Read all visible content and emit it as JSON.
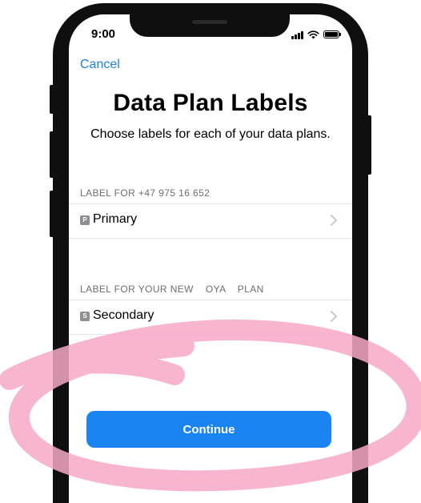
{
  "status_bar": {
    "time": "9:00",
    "icons": [
      "signal-icon",
      "wifi-icon",
      "battery-icon"
    ]
  },
  "nav": {
    "cancel_label": "Cancel"
  },
  "header": {
    "title": "Data Plan Labels",
    "subtitle": "Choose labels for each of your data plans."
  },
  "sections": [
    {
      "header": "LABEL FOR +47 975 16 652",
      "row": {
        "badge": "P",
        "label": "Primary"
      }
    },
    {
      "header": "LABEL FOR YOUR NEW    OYA    PLAN",
      "row": {
        "badge": "S",
        "label": "Secondary"
      }
    }
  ],
  "footer": {
    "continue_label": "Continue"
  },
  "colors": {
    "accent": "#1a84f2",
    "link": "#1a84e6",
    "annotation": "#f7a8c8",
    "frame": "#0f0f10"
  }
}
